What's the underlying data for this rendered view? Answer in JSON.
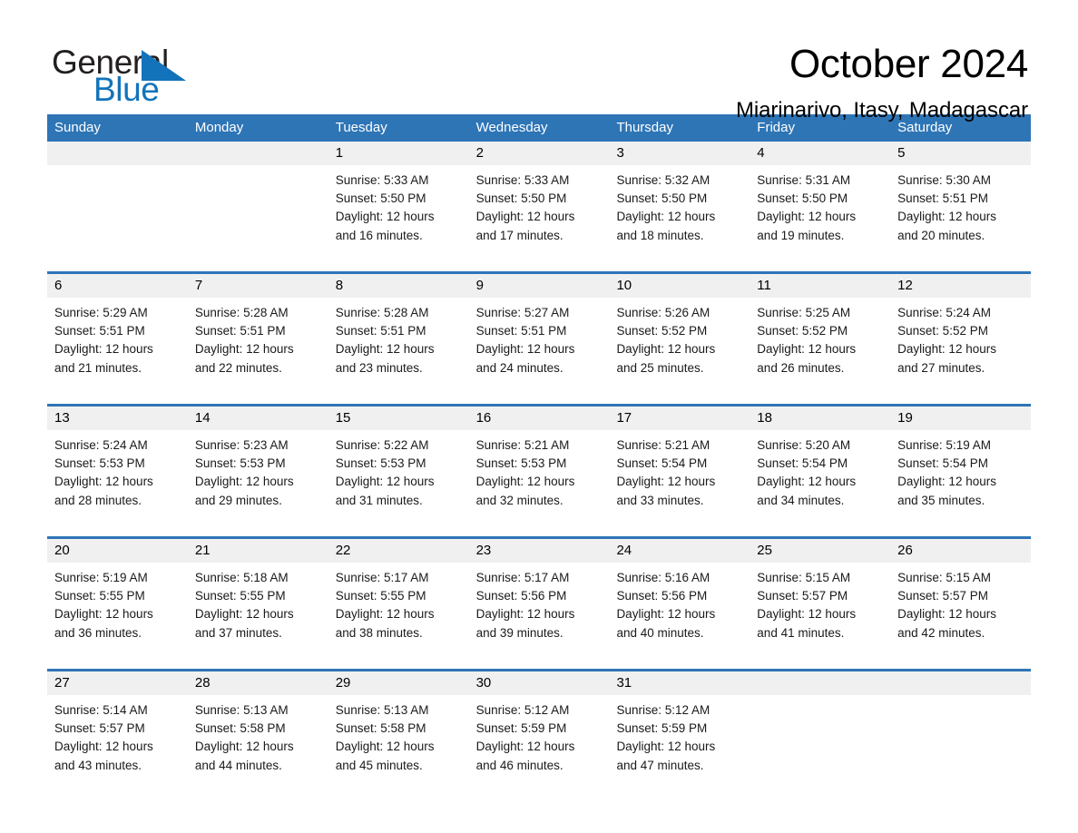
{
  "brand": {
    "word_one": "General",
    "word_two": "Blue",
    "triangle_color": "#1273bb",
    "text_color": "#231f20"
  },
  "header": {
    "title": "October 2024",
    "location": "Miarinarivo, Itasy, Madagascar"
  },
  "theme": {
    "header_blue": "#2e75b6",
    "daynum_band": "#f0f0f0",
    "cell_background": "#ffffff"
  },
  "calendar": {
    "weekdays": [
      "Sunday",
      "Monday",
      "Tuesday",
      "Wednesday",
      "Thursday",
      "Friday",
      "Saturday"
    ],
    "weeks": [
      [
        {
          "day": "",
          "text": ""
        },
        {
          "day": "",
          "text": ""
        },
        {
          "day": "1",
          "text": "Sunrise: 5:33 AM\nSunset: 5:50 PM\nDaylight: 12 hours\nand 16 minutes."
        },
        {
          "day": "2",
          "text": "Sunrise: 5:33 AM\nSunset: 5:50 PM\nDaylight: 12 hours\nand 17 minutes."
        },
        {
          "day": "3",
          "text": "Sunrise: 5:32 AM\nSunset: 5:50 PM\nDaylight: 12 hours\nand 18 minutes."
        },
        {
          "day": "4",
          "text": "Sunrise: 5:31 AM\nSunset: 5:50 PM\nDaylight: 12 hours\nand 19 minutes."
        },
        {
          "day": "5",
          "text": "Sunrise: 5:30 AM\nSunset: 5:51 PM\nDaylight: 12 hours\nand 20 minutes."
        }
      ],
      [
        {
          "day": "6",
          "text": "Sunrise: 5:29 AM\nSunset: 5:51 PM\nDaylight: 12 hours\nand 21 minutes."
        },
        {
          "day": "7",
          "text": "Sunrise: 5:28 AM\nSunset: 5:51 PM\nDaylight: 12 hours\nand 22 minutes."
        },
        {
          "day": "8",
          "text": "Sunrise: 5:28 AM\nSunset: 5:51 PM\nDaylight: 12 hours\nand 23 minutes."
        },
        {
          "day": "9",
          "text": "Sunrise: 5:27 AM\nSunset: 5:51 PM\nDaylight: 12 hours\nand 24 minutes."
        },
        {
          "day": "10",
          "text": "Sunrise: 5:26 AM\nSunset: 5:52 PM\nDaylight: 12 hours\nand 25 minutes."
        },
        {
          "day": "11",
          "text": "Sunrise: 5:25 AM\nSunset: 5:52 PM\nDaylight: 12 hours\nand 26 minutes."
        },
        {
          "day": "12",
          "text": "Sunrise: 5:24 AM\nSunset: 5:52 PM\nDaylight: 12 hours\nand 27 minutes."
        }
      ],
      [
        {
          "day": "13",
          "text": "Sunrise: 5:24 AM\nSunset: 5:53 PM\nDaylight: 12 hours\nand 28 minutes."
        },
        {
          "day": "14",
          "text": "Sunrise: 5:23 AM\nSunset: 5:53 PM\nDaylight: 12 hours\nand 29 minutes."
        },
        {
          "day": "15",
          "text": "Sunrise: 5:22 AM\nSunset: 5:53 PM\nDaylight: 12 hours\nand 31 minutes."
        },
        {
          "day": "16",
          "text": "Sunrise: 5:21 AM\nSunset: 5:53 PM\nDaylight: 12 hours\nand 32 minutes."
        },
        {
          "day": "17",
          "text": "Sunrise: 5:21 AM\nSunset: 5:54 PM\nDaylight: 12 hours\nand 33 minutes."
        },
        {
          "day": "18",
          "text": "Sunrise: 5:20 AM\nSunset: 5:54 PM\nDaylight: 12 hours\nand 34 minutes."
        },
        {
          "day": "19",
          "text": "Sunrise: 5:19 AM\nSunset: 5:54 PM\nDaylight: 12 hours\nand 35 minutes."
        }
      ],
      [
        {
          "day": "20",
          "text": "Sunrise: 5:19 AM\nSunset: 5:55 PM\nDaylight: 12 hours\nand 36 minutes."
        },
        {
          "day": "21",
          "text": "Sunrise: 5:18 AM\nSunset: 5:55 PM\nDaylight: 12 hours\nand 37 minutes."
        },
        {
          "day": "22",
          "text": "Sunrise: 5:17 AM\nSunset: 5:55 PM\nDaylight: 12 hours\nand 38 minutes."
        },
        {
          "day": "23",
          "text": "Sunrise: 5:17 AM\nSunset: 5:56 PM\nDaylight: 12 hours\nand 39 minutes."
        },
        {
          "day": "24",
          "text": "Sunrise: 5:16 AM\nSunset: 5:56 PM\nDaylight: 12 hours\nand 40 minutes."
        },
        {
          "day": "25",
          "text": "Sunrise: 5:15 AM\nSunset: 5:57 PM\nDaylight: 12 hours\nand 41 minutes."
        },
        {
          "day": "26",
          "text": "Sunrise: 5:15 AM\nSunset: 5:57 PM\nDaylight: 12 hours\nand 42 minutes."
        }
      ],
      [
        {
          "day": "27",
          "text": "Sunrise: 5:14 AM\nSunset: 5:57 PM\nDaylight: 12 hours\nand 43 minutes."
        },
        {
          "day": "28",
          "text": "Sunrise: 5:13 AM\nSunset: 5:58 PM\nDaylight: 12 hours\nand 44 minutes."
        },
        {
          "day": "29",
          "text": "Sunrise: 5:13 AM\nSunset: 5:58 PM\nDaylight: 12 hours\nand 45 minutes."
        },
        {
          "day": "30",
          "text": "Sunrise: 5:12 AM\nSunset: 5:59 PM\nDaylight: 12 hours\nand 46 minutes."
        },
        {
          "day": "31",
          "text": "Sunrise: 5:12 AM\nSunset: 5:59 PM\nDaylight: 12 hours\nand 47 minutes."
        },
        {
          "day": "",
          "text": ""
        },
        {
          "day": "",
          "text": ""
        }
      ]
    ]
  }
}
